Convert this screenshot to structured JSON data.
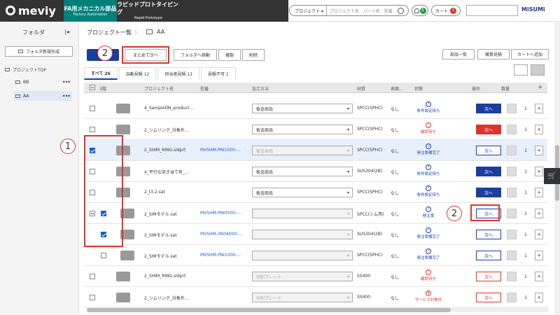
{
  "header": {
    "logo": "meviy",
    "tab_fa": "FA用メカニカル部品",
    "tab_fa_sub": "Factory Automation",
    "tab_rp": "ラピッドプロトタイピング",
    "tab_rp_sub": "Rapid Prototype",
    "search_select": "プロジェクト ▾",
    "search_placeholder": "プロジェクト名　パーツ名　型番",
    "notif_count": "0",
    "cart_label": "カート",
    "cart_count": "2",
    "brand": "MiSUMi"
  },
  "sidebar": {
    "title": "フォルダ",
    "collapse": "|◂",
    "new_folder": "フォルダ新規作成",
    "top": "プロジェクトTOP",
    "items": [
      {
        "label": "BB",
        "menu": "•••"
      },
      {
        "label": "AA",
        "menu": "•••"
      }
    ]
  },
  "main": {
    "breadcrumb_root": "プロジェクト一覧",
    "breadcrumb_sep": "〉",
    "breadcrumb_current": "AA",
    "toolbar": {
      "batch_next": "まとめて次へ",
      "move_folder": "フォルダへ移動",
      "copy": "複製",
      "delete": "削除",
      "parts_list": "部品一覧",
      "estimate": "概算見積",
      "add_cart": "カートへ追加"
    },
    "annot1": "1",
    "annot2": "2",
    "tabs": [
      {
        "label": "すべて 26"
      },
      {
        "label": "自動見積 12"
      },
      {
        "label": "担当者見積 13"
      },
      {
        "label": "見積不可 1"
      }
    ],
    "columns": {
      "level": "3階",
      "name": "プロジェクト名",
      "model": "型番",
      "method": "加工方法",
      "material": "材質",
      "surface": "表面...",
      "status": "状態",
      "action": "操作",
      "qty": "数量",
      "add": "+"
    },
    "rows": [
      {
        "name": "4_SampleDN_product...",
        "model": "",
        "method": "板金部品",
        "material": "SPCC(SPHC)",
        "surface": "なし",
        "status_icon": "?",
        "status": "条件設定待ち",
        "action": "次へ",
        "qty": "1"
      },
      {
        "name": "2_シムリング_対象外...",
        "model": "",
        "method": "板金部品",
        "material": "SPCC(SPHC)",
        "surface": "なし",
        "status_icon": "!",
        "status": "確認待ち",
        "action": "次へ",
        "qty": "1"
      },
      {
        "name": "2_SHIM_RING.sldprt",
        "model": "MVSHM-PNI1000-...",
        "method": "板金部品",
        "material": "SPCC(SPHC)",
        "surface": "なし",
        "status_icon": "✓",
        "status": "発注準備完了",
        "action": "次へ",
        "qty": "1"
      },
      {
        "name": "4_平行な突き当て有_...",
        "model": "",
        "method": "板金部品",
        "material": "SUS304(2B)",
        "surface": "なし",
        "status_icon": "?",
        "status": "条件設定待ち",
        "action": "次へ",
        "qty": "1"
      },
      {
        "name": "2_t3.2.sat",
        "model": "",
        "method": "板金部品",
        "material": "SPCC(SPHC)",
        "surface": "なし",
        "status_icon": "?",
        "status": "条件設定待ち",
        "action": "次へ",
        "qty": "1"
      },
      {
        "name": "2_SIMモデル.sat",
        "model": "MVSHM-PNI0500-...",
        "method": "",
        "material": "SPCC(シム用)",
        "surface": "なし",
        "status_icon": "✓",
        "status": "発注準",
        "action": "次へ",
        "qty": "1"
      },
      {
        "name": "2_SIMモデル.sat",
        "model": "MVSHM-3N04000-...",
        "method": "",
        "material": "SUS304(2B)",
        "surface": "なし",
        "status_icon": "✓",
        "status": "発注準備完了",
        "action": "次へ",
        "qty": "1"
      },
      {
        "name": "2_SIMモデル.sat",
        "model": "MVSHM-PNI1000-...",
        "method": "",
        "material": "SPCC(SPHC)",
        "surface": "なし",
        "status_icon": "✓",
        "status": "発注準備完了",
        "action": "次へ",
        "qty": "1"
      },
      {
        "name": "2_SHIM_RING.sldprt",
        "model": "",
        "method": "切削プレート",
        "material": "SS400",
        "surface": "なし",
        "status_icon": "!",
        "status": "確認待ち",
        "action": "次へ",
        "qty": "1"
      },
      {
        "name": "2_シムリング_対象外...",
        "model": "",
        "method": "切削プレート",
        "material": "SS400",
        "surface": "なし",
        "status_icon": "⊗",
        "status": "サービス対象外",
        "action": "次へ",
        "qty": "1"
      }
    ]
  }
}
